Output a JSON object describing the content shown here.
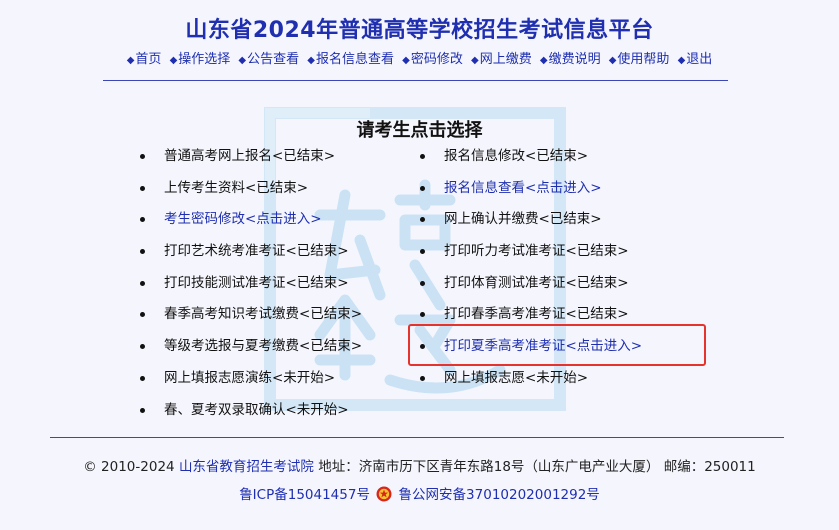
{
  "header": {
    "title": "山东省2024年普通高等学校招生考试信息平台",
    "nav": [
      "首页",
      "操作选择",
      "公告查看",
      "报名信息查看",
      "密码修改",
      "网上缴费",
      "缴费说明",
      "使用帮助",
      "退出"
    ],
    "nav_bullet": "◆"
  },
  "main": {
    "section_title": "请考生点击选择",
    "left_items": [
      {
        "label": "普通高考网上报名<已结束>",
        "link": false
      },
      {
        "label": "上传考生资料<已结束>",
        "link": false
      },
      {
        "label": "考生密码修改<点击进入>",
        "link": true
      },
      {
        "label": "打印艺术统考准考证<已结束>",
        "link": false
      },
      {
        "label": "打印技能测试准考证<已结束>",
        "link": false
      },
      {
        "label": "春季高考知识考试缴费<已结束>",
        "link": false
      },
      {
        "label": "等级考选报与夏考缴费<已结束>",
        "link": false
      },
      {
        "label": "网上填报志愿演练<未开始>",
        "link": false
      },
      {
        "label": "春、夏考双录取确认<未开始>",
        "link": false
      }
    ],
    "right_items": [
      {
        "label": "报名信息修改<已结束>",
        "link": false
      },
      {
        "label": "报名信息查看<点击进入>",
        "link": true
      },
      {
        "label": "网上确认并缴费<已结束>",
        "link": false
      },
      {
        "label": "打印听力考试准考证<已结束>",
        "link": false
      },
      {
        "label": "打印体育测试准考证<已结束>",
        "link": false
      },
      {
        "label": "打印春季高考准考证<已结束>",
        "link": false
      },
      {
        "label": "打印夏季高考准考证<点击进入>",
        "link": true
      },
      {
        "label": "网上填报志愿<未开始>",
        "link": false
      }
    ]
  },
  "footer": {
    "copyright": "© 2010-2024",
    "org": "山东省教育招生考试院",
    "address": "地址：济南市历下区青年东路18号（山东广电产业大厦） 邮编：250011",
    "icp": "鲁ICP备15041457号",
    "police": "鲁公网安备37010202001292号"
  },
  "colors": {
    "link": "#1f2fb0",
    "highlight": "#e5332e",
    "background": "#f5f6fd"
  }
}
